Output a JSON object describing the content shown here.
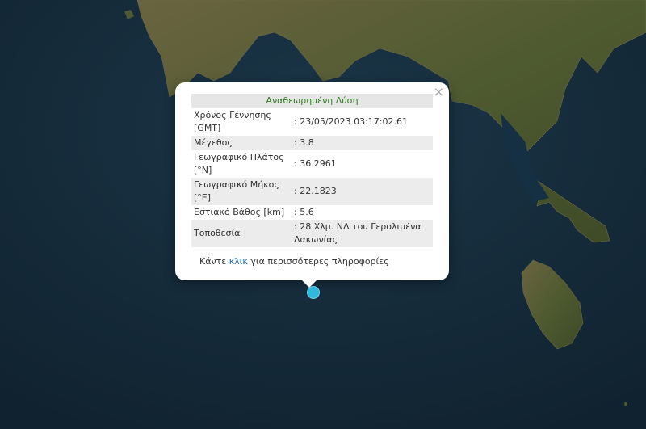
{
  "popup": {
    "close_label": "×",
    "header": "Αναθεωρημένη Λύση",
    "rows": [
      {
        "label": "Χρόνος Γέννησης [GMT]",
        "value": ": 23/05/2023 03:17:02.61"
      },
      {
        "label": "Μέγεθος",
        "value": ": 3.8"
      },
      {
        "label": "Γεωγραφικό Πλάτος [°N]",
        "value": ": 36.2961"
      },
      {
        "label": "Γεωγραφικό Μήκος [°E]",
        "value": ": 22.1823"
      },
      {
        "label": "Εστιακό Βάθος [km]",
        "value": ": 5.6"
      },
      {
        "label": "Τοποθεσία",
        "value": ": 28 Χλμ. ΝΔ του Γερολιμένα Λακωνίας"
      }
    ],
    "more_prefix": "Κάντε ",
    "more_link": "κλικ",
    "more_suffix": " για περισσότερες πληροφορίες"
  },
  "colors": {
    "sea": "#142a3a",
    "land": "#4a5a2e",
    "marker": "#33b8dd",
    "header_text": "#2e7d1f",
    "link": "#1a6fb5"
  },
  "icons": {
    "close": "close-icon",
    "marker": "earthquake-marker-icon"
  }
}
